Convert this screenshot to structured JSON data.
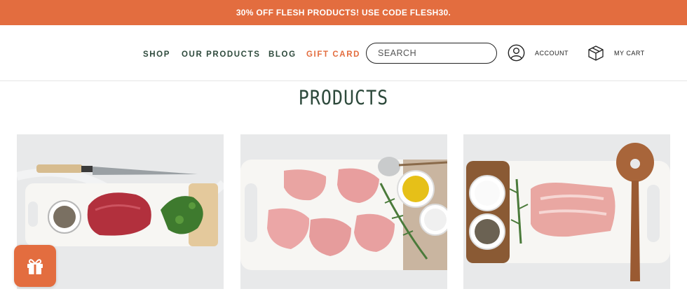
{
  "promo": {
    "text": "30% OFF FLESH PRODUCTS! USE CODE FLESH30."
  },
  "nav": {
    "items": [
      {
        "label": "SHOP"
      },
      {
        "label": "OUR PRODUCTS"
      },
      {
        "label": "BLOG"
      },
      {
        "label": "GIFT CARD"
      }
    ]
  },
  "search": {
    "placeholder": "SEARCH",
    "value": ""
  },
  "account": {
    "label": "ACCOUNT",
    "icon": "user-icon"
  },
  "cart": {
    "label": "MY CART",
    "icon": "box-icon"
  },
  "main": {
    "title": "PRODUCTS"
  },
  "products": [
    {
      "image": "beef-steak-on-board"
    },
    {
      "image": "chicken-thighs-on-board"
    },
    {
      "image": "pork-roast-on-board"
    }
  ],
  "gift_widget": {
    "icon": "gift-icon"
  },
  "colors": {
    "brand_orange": "#e36d3f",
    "brand_green": "#2e4a3c"
  }
}
